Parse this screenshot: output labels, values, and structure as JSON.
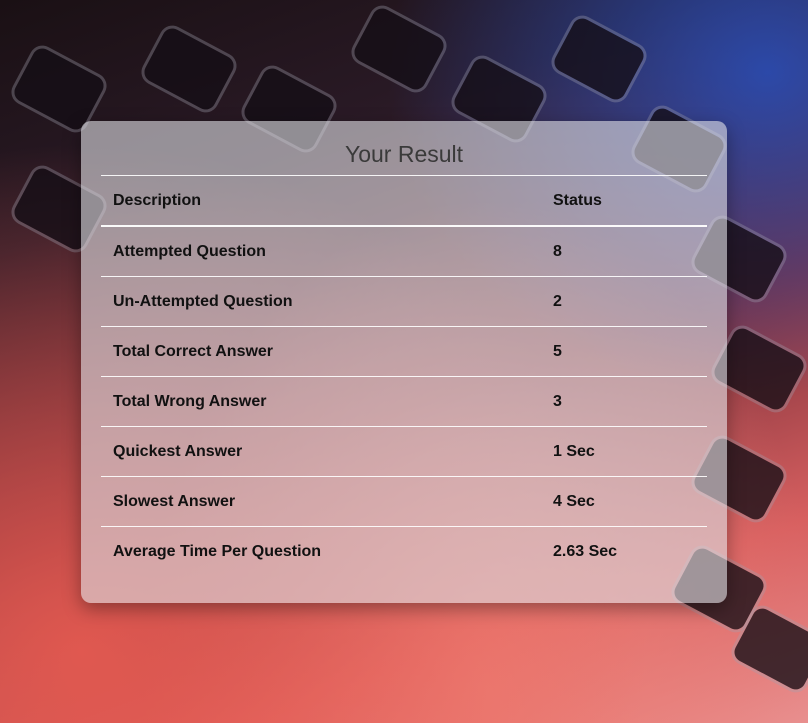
{
  "result": {
    "title": "Your Result",
    "columns": {
      "description": "Description",
      "status": "Status"
    },
    "rows": [
      {
        "description": "Attempted Question",
        "status": "8"
      },
      {
        "description": "Un-Attempted Question",
        "status": "2"
      },
      {
        "description": "Total Correct Answer",
        "status": "5"
      },
      {
        "description": "Total Wrong Answer",
        "status": "3"
      },
      {
        "description": "Quickest Answer",
        "status": "1 Sec"
      },
      {
        "description": "Slowest Answer",
        "status": "4 Sec"
      },
      {
        "description": "Average Time Per Question",
        "status": "2.63 Sec"
      }
    ]
  }
}
